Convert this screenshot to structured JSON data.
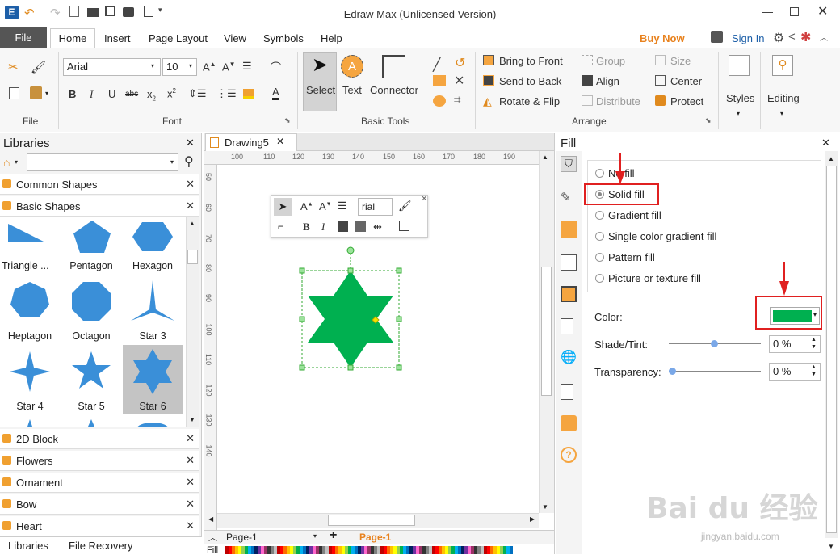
{
  "app": {
    "title": "Edraw Max (Unlicensed Version)"
  },
  "menu": {
    "file": "File",
    "tabs": [
      "Home",
      "Insert",
      "Page Layout",
      "View",
      "Symbols",
      "Help"
    ],
    "buy_now": "Buy Now",
    "sign_in": "Sign In"
  },
  "ribbon": {
    "groups": {
      "file": "File",
      "font": "Font",
      "basic_tools": "Basic Tools",
      "arrange": "Arrange"
    },
    "font_name": "Arial",
    "font_size": "10",
    "tools": {
      "select": "Select",
      "text": "Text",
      "connector": "Connector"
    },
    "arrange": {
      "bring_to_front": "Bring to Front",
      "send_to_back": "Send to Back",
      "rotate_flip": "Rotate & Flip",
      "group": "Group",
      "align": "Align",
      "distribute": "Distribute",
      "size": "Size",
      "center": "Center",
      "protect": "Protect"
    },
    "styles": "Styles",
    "editing": "Editing"
  },
  "libraries": {
    "title": "Libraries",
    "categories_top": [
      "Common Shapes",
      "Basic Shapes"
    ],
    "shapes": [
      "Triangle ...",
      "Pentagon",
      "Hexagon",
      "Heptagon",
      "Octagon",
      "Star 3",
      "Star 4",
      "Star 5",
      "Star 6"
    ],
    "categories_bottom": [
      "2D Block",
      "Flowers",
      "Ornament",
      "Bow",
      "Heart"
    ],
    "bottom_tabs": [
      "Libraries",
      "File Recovery"
    ]
  },
  "document": {
    "tab": "Drawing5",
    "page_select": "Page-1",
    "page_tab": "Page-1",
    "fill_label": "Fill",
    "ruler_top": [
      "100",
      "110",
      "120",
      "130",
      "140",
      "150",
      "160",
      "170",
      "180",
      "190"
    ],
    "ruler_left": [
      "50",
      "60",
      "70",
      "80",
      "90",
      "100",
      "110",
      "120",
      "130",
      "140"
    ],
    "mini_font": "rial"
  },
  "fill_panel": {
    "title": "Fill",
    "options": [
      "No fill",
      "Solid fill",
      "Gradient fill",
      "Single color gradient fill",
      "Pattern fill",
      "Picture or texture fill"
    ],
    "selected": "Solid fill",
    "color_label": "Color:",
    "color_value": "#00b050",
    "shade_label": "Shade/Tint:",
    "shade_value": "0 %",
    "transparency_label": "Transparency:",
    "transparency_value": "0 %"
  },
  "shape": {
    "fill": "#00b050"
  },
  "watermark": {
    "brand": "Bai du 经验",
    "url": "jingyan.baidu.com"
  }
}
